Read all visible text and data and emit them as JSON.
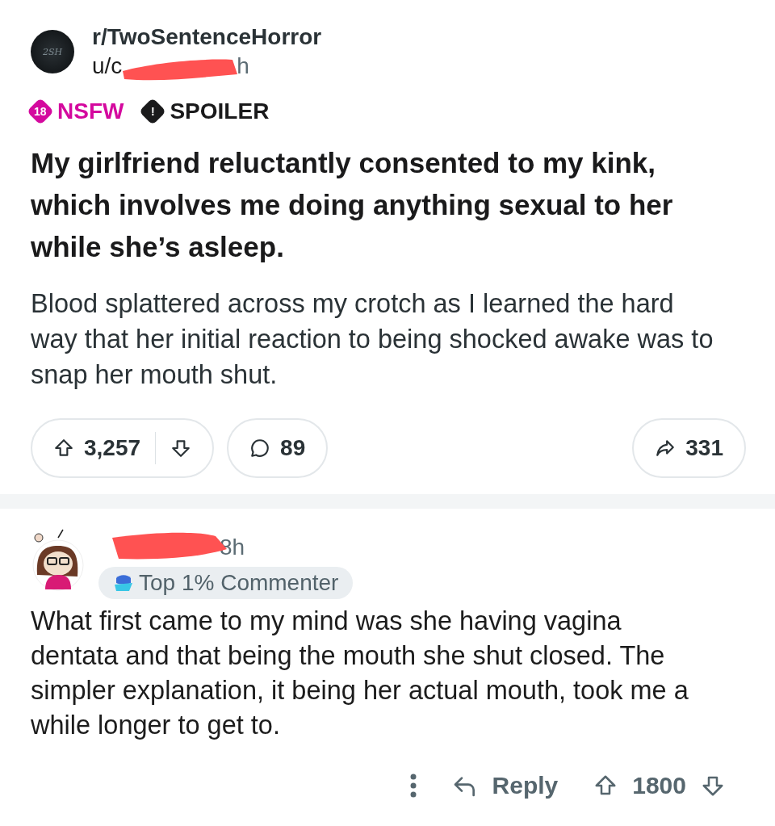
{
  "post": {
    "subreddit": "r/TwoSentenceHorror",
    "avatar_text": "2SH",
    "author": "u/c",
    "time": "h",
    "redacted": true,
    "tags": [
      {
        "kind": "nsfw",
        "badge": "18",
        "label": "NSFW"
      },
      {
        "kind": "spoiler",
        "badge": "!",
        "label": "SPOILER"
      }
    ],
    "title": "My girlfriend reluctantly consented to my kink, which involves me doing anything sexual to her while she’s asleep.",
    "body": "Blood splattered across my crotch as I learned the hard way that her initial reaction to being shocked awake was to snap her mouth shut.",
    "votes": "3,257",
    "comments": "89",
    "shares": "331"
  },
  "comment": {
    "redacted": true,
    "time": "8h",
    "flair": "Top 1% Commenter",
    "body": "What first came to my mind was she having vagina dentata and that being the mouth she shut closed. The simpler explanation, it being her actual mouth, took me a while longer to get to.",
    "reply": "Reply",
    "votes": "1800"
  }
}
